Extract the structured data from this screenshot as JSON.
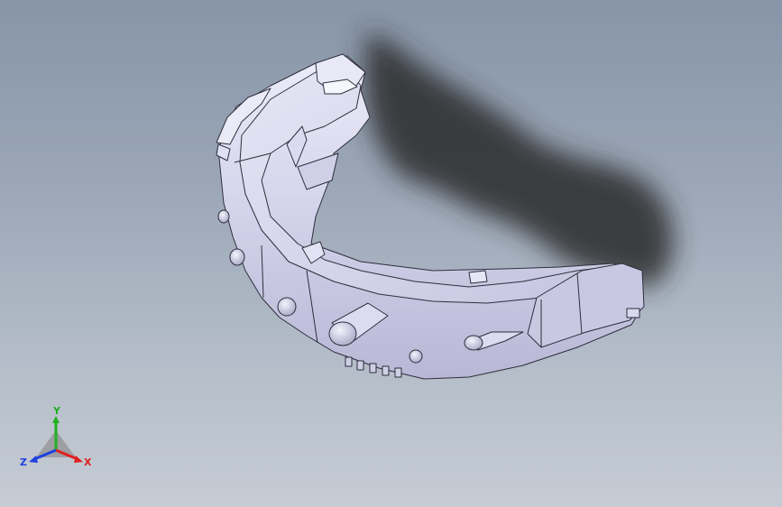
{
  "viewport": {
    "background_top": "#8795a8",
    "background_bottom": "#c6ccd4"
  },
  "model": {
    "face_color": "#d4d4ec",
    "edge_color": "#2e2e3c",
    "shadow_color": "#2a2a2a"
  },
  "triad": {
    "x_label": "X",
    "y_label": "Y",
    "z_label": "Z",
    "x_color": "#e02020",
    "y_color": "#20b020",
    "z_color": "#2040e0"
  }
}
